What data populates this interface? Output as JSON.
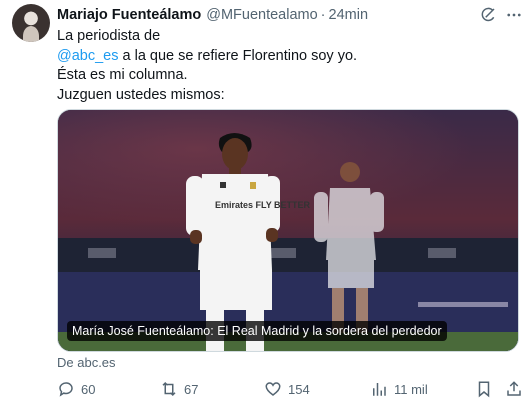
{
  "author": {
    "name": "Mariajo Fuenteálamo",
    "handle": "@MFuentealamo",
    "separator": "·",
    "time": "24min"
  },
  "tweet": {
    "line1": "La periodista de",
    "mention": "@abc_es",
    "line2_rest": " a la que se refiere Florentino soy yo.",
    "line3": "Ésta es mi columna.",
    "line4": "Juzguen ustedes mismos:"
  },
  "media": {
    "caption": "María José Fuenteálamo: El Real Madrid y la sordera del perdedor",
    "jersey_text": "Emirates FLY BETTER"
  },
  "source": "De abc.es",
  "actions": {
    "replies": "60",
    "reposts": "67",
    "likes": "154",
    "views": "11 mil"
  },
  "colors": {
    "link": "#1d9bf0",
    "muted": "#536471",
    "text": "#0f1419"
  },
  "icons": [
    "grok-icon",
    "more-icon",
    "reply-icon",
    "repost-icon",
    "like-icon",
    "views-icon",
    "bookmark-icon",
    "share-icon"
  ]
}
